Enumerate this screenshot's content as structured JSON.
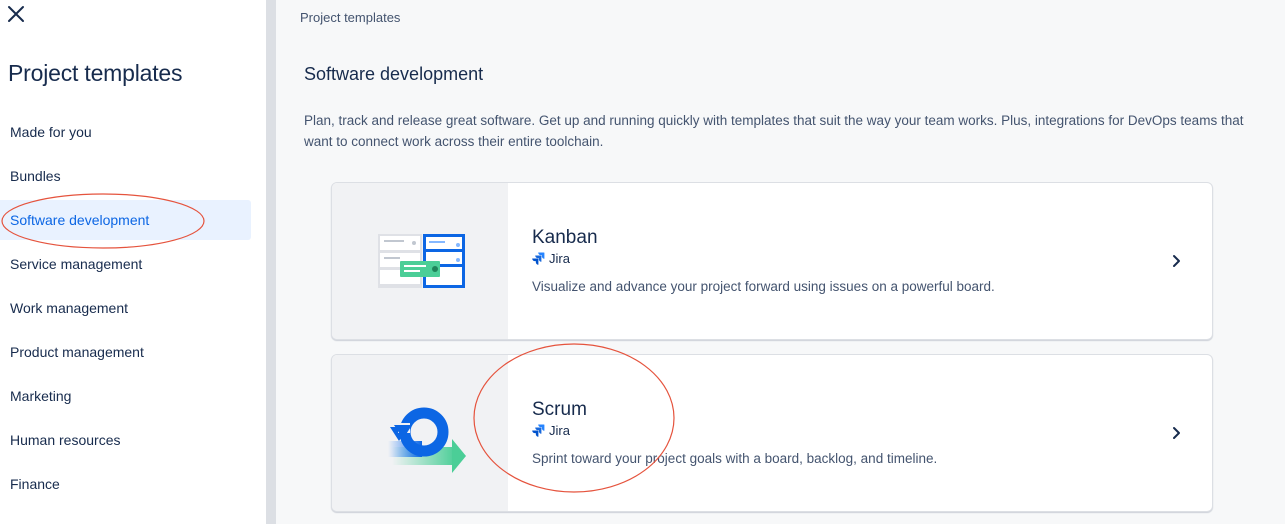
{
  "sidebar": {
    "title": "Project templates",
    "items": [
      {
        "label": "Made for you"
      },
      {
        "label": "Bundles"
      },
      {
        "label": "Software development",
        "active": true
      },
      {
        "label": "Service management"
      },
      {
        "label": "Work management"
      },
      {
        "label": "Product management"
      },
      {
        "label": "Marketing"
      },
      {
        "label": "Human resources"
      },
      {
        "label": "Finance"
      }
    ]
  },
  "main": {
    "breadcrumb": "Project templates",
    "section_title": "Software development",
    "section_description": "Plan, track and release great software. Get up and running quickly with templates that suit the way your team works. Plus, integrations for DevOps teams that want to connect work across their entire toolchain.",
    "cards": [
      {
        "title": "Kanban",
        "app": "Jira",
        "description": "Visualize and advance your project forward using issues on a powerful board.",
        "icon": "kanban-board-illustration"
      },
      {
        "title": "Scrum",
        "app": "Jira",
        "description": "Sprint toward your project goals with a board, backlog, and timeline.",
        "icon": "scrum-cycle-illustration"
      }
    ]
  },
  "colors": {
    "accent": "#0c66e4",
    "active_bg": "#e9f2ff",
    "annotation": "#e5533d"
  }
}
